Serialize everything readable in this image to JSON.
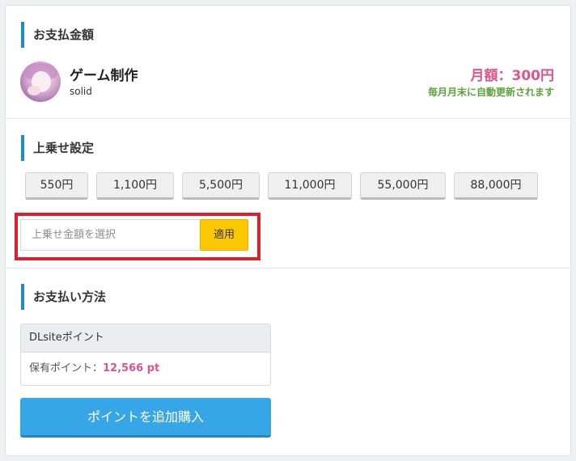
{
  "payment": {
    "heading": "お支払金額",
    "creator": {
      "name": "ゲーム制作",
      "plan": "solid"
    },
    "price": "月額：300円",
    "renewal_note": "毎月月末に自動更新されます"
  },
  "topup": {
    "heading": "上乗せ設定",
    "amounts": [
      "550円",
      "1,100円",
      "5,500円",
      "11,000円",
      "55,000円",
      "88,000円"
    ],
    "select_placeholder": "上乗せ金額を選択",
    "apply_label": "適用"
  },
  "method": {
    "heading": "お支払い方法",
    "points_title": "DLsiteポイント",
    "points_label": "保有ポイント：",
    "points_value": "12,566 pt",
    "buy_label": "ポイントを追加購入"
  },
  "colors": {
    "accent_bar": "#1f8ac8",
    "price": "#e0548a",
    "renewal": "#5ba33a",
    "apply_button": "#fbc800",
    "buy_button": "#36a6e6",
    "highlight_box": "#d9202c"
  }
}
